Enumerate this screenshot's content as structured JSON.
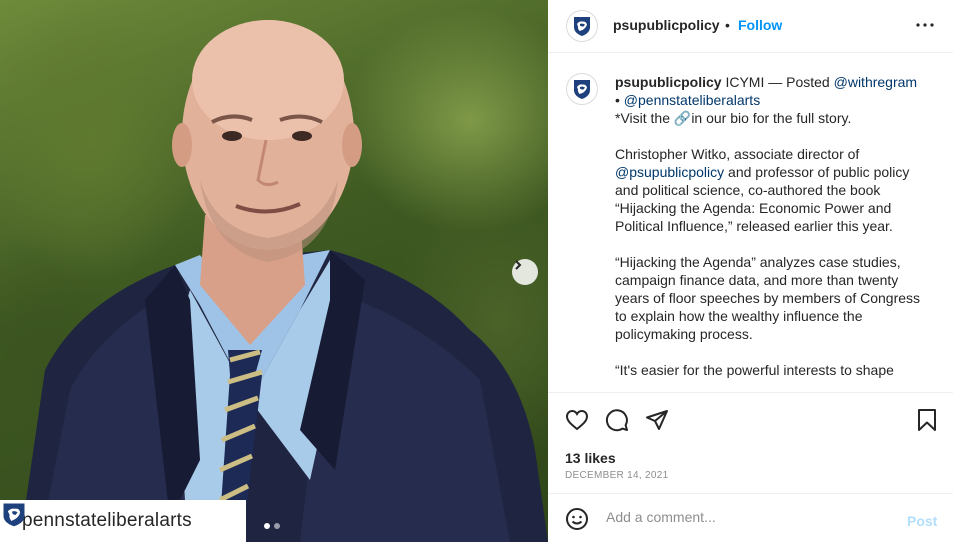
{
  "post": {
    "author": "psupublicpolicy",
    "follow_label": "Follow",
    "separator": "•",
    "caption": {
      "author": "psupublicpolicy",
      "line1_text": " ICYMI — Posted ",
      "mention1": "@withregram",
      "line2_prefix": "• ",
      "mention2": "@pennstateliberalarts",
      "visit_text": "*Visit the 🔗in our bio for the full story.",
      "para1_a": "Christopher Witko, associate director of ",
      "para1_mention": "@psupublicpolicy",
      "para1_b": " and professor of public policy and political science, co-authored the book “Hijacking the Agenda: Economic Power and Political Influence,” released earlier this year.",
      "para2": "“Hijacking the Agenda” analyzes case studies, campaign finance data, and more than twenty years of floor speeches by members of Congress to explain how the wealthy influence the policymaking process.",
      "para3": "“It's easier for the powerful interests to shape"
    },
    "likes": "13 likes",
    "date": "DECEMBER 14, 2021",
    "comment_placeholder": "Add a comment...",
    "post_label": "Post"
  },
  "media": {
    "credit_account": "pennstateliberalarts",
    "slide_count": 2,
    "active_slide": 1
  },
  "icons": {
    "header_more": "more-options-icon",
    "like": "heart-icon",
    "comment": "comment-icon",
    "share": "share-icon",
    "save": "bookmark-icon",
    "emoji": "emoji-icon",
    "next": "chevron-right-icon"
  },
  "colors": {
    "link": "#0095f6",
    "mention": "#00376b",
    "post_disabled": "#b2dffc",
    "psu_navy": "#1e407c"
  }
}
